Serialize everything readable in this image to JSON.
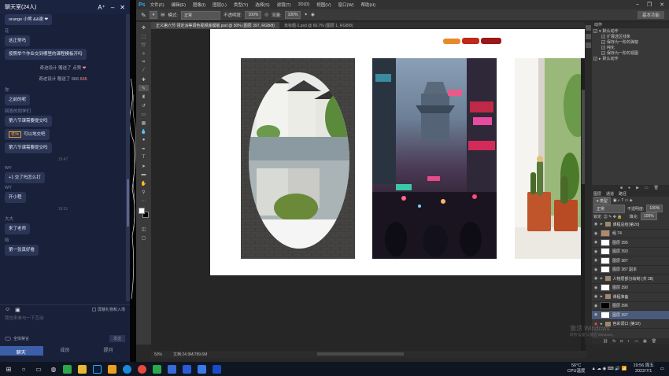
{
  "chat": {
    "title": "聊天室(24人)",
    "font_btn": "A⁺",
    "messages": [
      {
        "kind": "partial",
        "text": "orange 小熊 &&谢 ❤"
      },
      {
        "kind": "msg",
        "name": "花",
        "text": "这正常吗",
        "cut": true
      },
      {
        "kind": "msg",
        "name": "",
        "text": "按照举个作业交到哪里的课程模板开吗"
      },
      {
        "kind": "gift",
        "text": "奇迹设计 赠送了 点赞",
        "icon": "❤"
      },
      {
        "kind": "gift",
        "text": "奇迹设计 赠送了 666",
        "icon": "666"
      },
      {
        "kind": "msg",
        "name": "你",
        "text": "之前的呢"
      },
      {
        "kind": "msg",
        "name": "回答的同学们",
        "text": "第六节课需要提交吗"
      },
      {
        "kind": "msg",
        "name": "",
        "tag": "老师",
        "text": "可以地交吧"
      },
      {
        "kind": "msg",
        "name": "",
        "text": "第六节课需要提交吗"
      },
      {
        "kind": "time",
        "text": "19:47"
      },
      {
        "kind": "msg",
        "name": "WY",
        "text": "+1  交了吗怎么打"
      },
      {
        "kind": "msg",
        "name": "WY",
        "text": "开小程"
      },
      {
        "kind": "time",
        "text": "19:51"
      },
      {
        "kind": "msg",
        "name": "大大",
        "text": "来了老师"
      },
      {
        "kind": "msg",
        "name": "哈",
        "text": "第一张真好看"
      }
    ],
    "block_gift_label": "屏蔽礼物和入场",
    "input_placeholder": "我也来参与一下互动",
    "mute_label": "全体禁言",
    "send_label": "发送",
    "tabs": [
      {
        "label": "聊天",
        "active": true,
        "badge": "•"
      },
      {
        "label": "成员",
        "active": false
      },
      {
        "label": "提问",
        "active": false
      }
    ]
  },
  "photoshop": {
    "menu": [
      "文件(F)",
      "编辑(E)",
      "图像(I)",
      "图层(L)",
      "类型(Y)",
      "选择(S)",
      "滤镜(T)",
      "3D(D)",
      "视图(V)",
      "窗口(W)",
      "帮助(H)"
    ],
    "options": {
      "mode_label": "模式:",
      "mode_value": "正常",
      "opacity_label": "不透明度:",
      "opacity_value": "100%",
      "flow_label": "流量:",
      "flow_value": "100%",
      "workspace": "基本功能"
    },
    "tabs": [
      {
        "label": "正义第六节 领定派等调色视频底模版.psd @ 50% (图层 397, RGB/8)",
        "active": true
      },
      {
        "label": "未标题-1.psd @ 66.7% (图层 1, RGB/8)",
        "active": false
      }
    ],
    "status_zoom": "50%",
    "status_doc": "文档:24.9M/789.6M",
    "history_header": "动作",
    "actions": [
      "默认动作",
      "扩展选区线条",
      "保存为一阶的弹窗",
      "纯化",
      "保存为一阶的视图",
      "默认动作"
    ],
    "layers_tabs": [
      "图层",
      "通道",
      "路径"
    ],
    "layers_mode": "正常",
    "layers_opacity_label": "不透明度:",
    "layers_opacity": "100%",
    "layers_fill_label": "填充:",
    "layers_fill": "100%",
    "layers": [
      {
        "name": "课程总结(第20)",
        "type": "folder",
        "selected": false
      },
      {
        "name": "组 74",
        "type": "thumb",
        "selected": false
      },
      {
        "name": "图层 395",
        "type": "thumb",
        "selected": false
      },
      {
        "name": "图层 393",
        "type": "thumb",
        "selected": false
      },
      {
        "name": "图层 387",
        "type": "thumb",
        "selected": false
      },
      {
        "name": "图层 387 副本",
        "type": "thumb",
        "selected": false
      },
      {
        "name": "人物层部分绘制 (共 38)",
        "type": "folder",
        "selected": false
      },
      {
        "name": "图层 390",
        "type": "thumb",
        "selected": false
      },
      {
        "name": "课程准备",
        "type": "folder",
        "selected": false
      },
      {
        "name": "图层 396",
        "type": "thumb",
        "selected": false
      },
      {
        "name": "图层 397",
        "type": "thumb",
        "selected": true
      },
      {
        "name": "色彩调口 (第10)",
        "type": "folder",
        "selected": false
      }
    ]
  },
  "taskbar": {
    "weather": "56°C",
    "weather_sub": "CPU温度",
    "time": "19:56 周五",
    "date": "2022/7/1"
  },
  "watermark": {
    "line1": "激活 Windows",
    "line2": "转到“设置”以激活 Windows。"
  }
}
